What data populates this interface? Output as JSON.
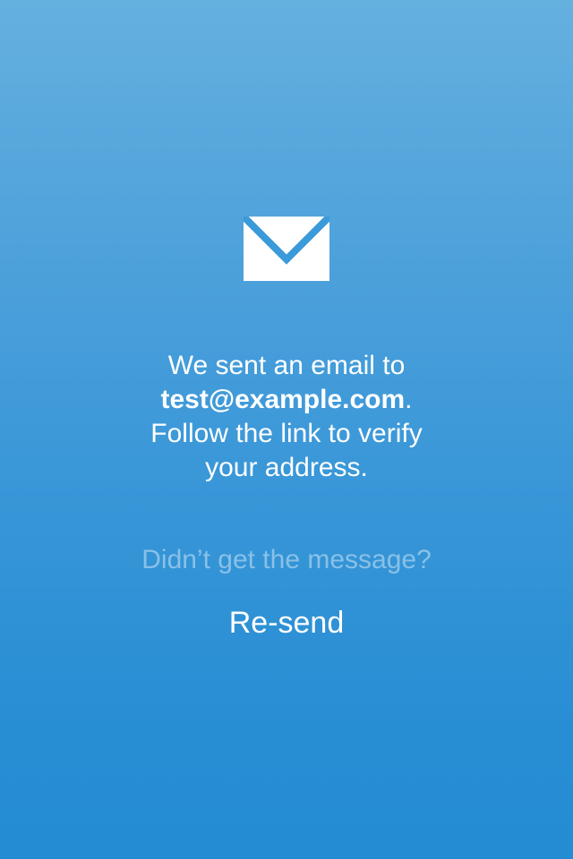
{
  "app": {
    "background_top": "#65b0df",
    "background_bottom": "#238cd3",
    "accent": "#ffffff"
  },
  "icon": {
    "name": "mail-icon"
  },
  "message": {
    "line1": "We sent an email to",
    "email": "test@example.com",
    "period": ".",
    "line3": "Follow the link to verify",
    "line4": "your address."
  },
  "prompt": {
    "text": "Didn’t get the message?"
  },
  "actions": {
    "resend_label": "Re-send"
  }
}
